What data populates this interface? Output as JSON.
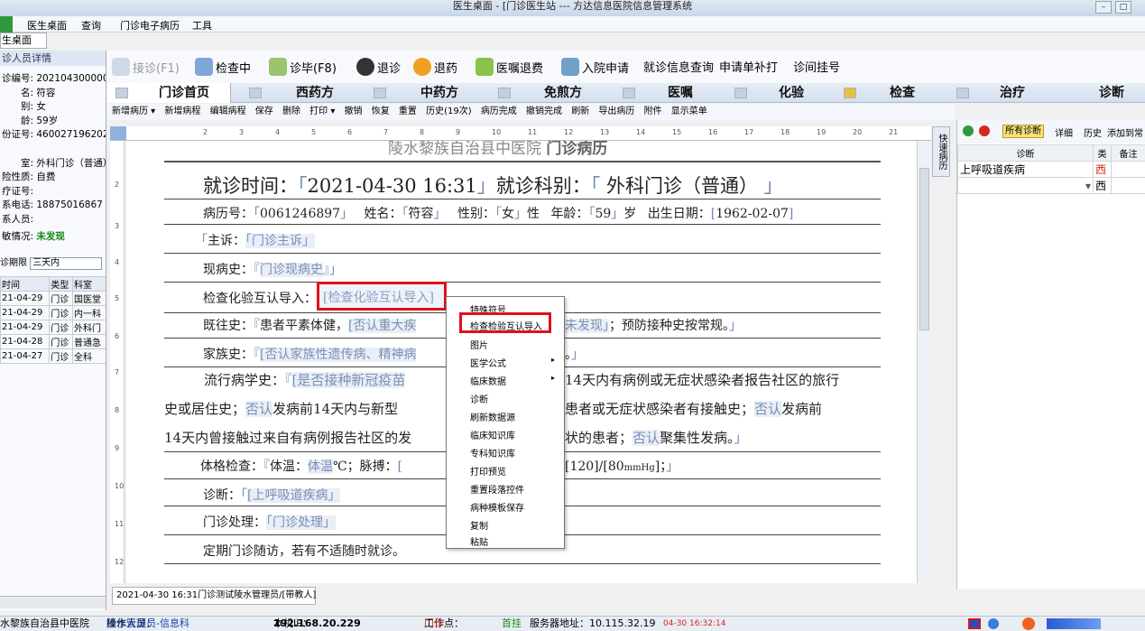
{
  "window": {
    "title": "医生桌面 - [门诊医生站 --- 方达信息医院信息管理系统"
  },
  "menubar": {
    "items": [
      "医生桌面",
      "查询",
      "门诊电子病历",
      "工具"
    ]
  },
  "left_tab": {
    "label": "生桌面",
    "close": "×"
  },
  "patient": {
    "section_title": "诊人员详情",
    "fields": [
      {
        "label": "诊编号:",
        "value": "2021043000008"
      },
      {
        "label": "名:",
        "value": "符容"
      },
      {
        "label": "别:",
        "value": "女"
      },
      {
        "label": "龄:",
        "value": "59岁"
      },
      {
        "label": "份证号:",
        "value": "4600271962020"
      },
      {
        "label": "室:",
        "value": "外科门诊（普通）"
      },
      {
        "label": "险性质:",
        "value": "自费"
      },
      {
        "label": "疗证号:",
        "value": ""
      },
      {
        "label": "系电话:",
        "value": "18875016867"
      },
      {
        "label": "系人员:",
        "value": ""
      },
      {
        "label": "敏情况:",
        "value": "未发现"
      }
    ],
    "visit_period_label": "诊期限",
    "visit_period_value": "三天内",
    "visits_headers": [
      "时间",
      "类型",
      "科室"
    ],
    "visits": [
      [
        "21-04-29",
        "门诊",
        "国医堂"
      ],
      [
        "21-04-29",
        "门诊",
        "内一科"
      ],
      [
        "21-04-29",
        "门诊",
        "外科门"
      ],
      [
        "21-04-28",
        "门诊",
        "普通急"
      ],
      [
        "21-04-27",
        "门诊",
        "全科"
      ]
    ]
  },
  "toolbar": {
    "buttons": [
      "接诊(F1)",
      "检查中",
      "诊毕(F8)",
      "退诊",
      "退药",
      "医嘱退费",
      "入院申请",
      "就诊信息查询",
      "申请单补打",
      "诊间挂号"
    ]
  },
  "tabs": [
    "门诊首页",
    "西药方",
    "中药方",
    "免煎方",
    "医嘱",
    "化验",
    "检查",
    "治疗",
    "诊断"
  ],
  "subbar": [
    "新增病历 ▾",
    "新增病程",
    "编辑病程",
    "保存",
    "删除",
    "打印 ▾",
    "撤销",
    "恢复",
    "重置",
    "历史(19次)",
    "病历完成",
    "撤销完成",
    "刷新",
    "导出病历",
    "附件",
    "显示菜单"
  ],
  "ruler_numbers": [
    "1",
    "2",
    "3",
    "4",
    "5",
    "6",
    "7",
    "8",
    "9",
    "10",
    "11",
    "12",
    "13",
    "14",
    "15",
    "16",
    "17",
    "18",
    "19",
    "20",
    "21"
  ],
  "vruler_numbers": [
    "1",
    "2",
    "3",
    "4",
    "5",
    "6",
    "7",
    "8",
    "9",
    "10",
    "11",
    "12"
  ],
  "doc": {
    "hospital": "陵水黎族自治县中医院",
    "doc_title": "门诊病历",
    "visit_time_label": "就诊时间：",
    "visit_time": "2021-04-30 16:31",
    "dept_label": "就诊科别：",
    "dept": "外科门诊（普通）",
    "record_no_label": "病历号：",
    "record_no": "0061246897",
    "name_label": "姓名：",
    "name": "符容",
    "sex_label": "性别：",
    "sex": "女",
    "sex_suffix": "性",
    "age_label": "年龄：",
    "age": "59",
    "age_unit": "岁",
    "dob_label": "出生日期：",
    "dob": "1962-02-07",
    "complaint_label": "主诉：",
    "complaint": "门诊主诉",
    "present_label": "现病史：",
    "present": "门诊现病史",
    "exam_import_label": "检查化验互认导入：",
    "exam_import": "检查化验互认导入",
    "past_label": "既往史：",
    "past_a": "患者平素体健，",
    "past_b": "否认重大疾",
    "past_c": "未发现",
    "past_d": "；预防接种史按常规。",
    "family_label": "家族史：",
    "family": "否认家族性遗传病、精神病",
    "family_end": "。",
    "epi_label": "流行病学史：",
    "epi_field": "是否接种新冠疫苗",
    "epi_text1": "14天内有病例或无症状感染者报告社区的旅行",
    "epi_text2a": "史或居住史；",
    "epi_no": "否认",
    "epi_text2b": "发病前14天内与新型",
    "epi_text2c": "患者或无症状感染者有接触史；",
    "epi_text2d": "发病前",
    "epi_text3a": "14天内曾接触过来自有病例报告社区的发",
    "epi_text3b": "状的患者；",
    "epi_text3c": "聚集性发病。",
    "physical_label": "体格检查：",
    "temp_label": "体温：",
    "temp_field": "体温",
    "temp_unit": "℃",
    "pulse_label": "；脉搏：",
    "bp": "[120]/[80",
    "bp_unit": "mmHg",
    "bp_end": "]；",
    "diag_label": "诊断：",
    "diag": "上呼吸道疾病",
    "treat_label": "门诊处理：",
    "treat": "门诊处理",
    "followup": "定期门诊随访，若有不适随时就诊。"
  },
  "context_menu": {
    "items": [
      "特殊符号",
      "检查检验互认导入",
      "图片",
      "医学公式",
      "临床数据",
      "诊断",
      "刷新数据源",
      "临床知识库",
      "专科知识库",
      "打印预览",
      "重置段落控件",
      "病种模板保存",
      "复制",
      "粘贴"
    ],
    "submenu_arrow": "▸"
  },
  "quick_tab": "快速病历",
  "right_panel": {
    "toolbar": [
      "所有诊断",
      "详细",
      "历史",
      "添加到常"
    ],
    "headers": [
      "诊断",
      "类",
      "备注"
    ],
    "rows": [
      {
        "diag": "上呼吸道疾病",
        "type": "西",
        "note": ""
      },
      {
        "diag": "",
        "type": "西",
        "note": ""
      }
    ]
  },
  "doc_tab": "2021-04-30 16:31门诊测试陵水管理员/[带教人]",
  "statusbar": {
    "hospital": "水黎族自治县中医院",
    "operator_label": "操作人员：",
    "operator": "陵水管理员-信息科",
    "ip_label": "本机IP：",
    "ip": "192.168.20.229",
    "workpoint_label": "工作点：",
    "workpoint": "门诊",
    "first": "首挂",
    "server": "服务器地址：10.115.32.19",
    "time": "04-30 16:32:14"
  },
  "colors": {
    "accent_red": "#e0101a",
    "allergy_green": "#1a8a1a",
    "field_blue": "#7a8fb4"
  }
}
